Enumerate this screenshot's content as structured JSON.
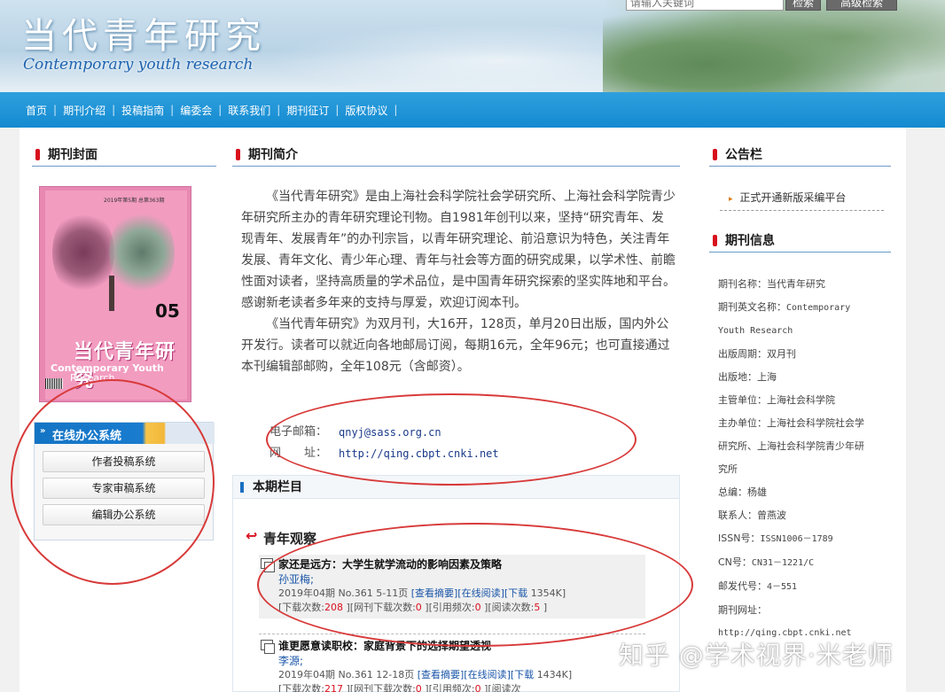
{
  "header": {
    "logo_cn": "当代青年研究",
    "logo_en": "Contemporary youth research",
    "search_placeholder": "请输入关键词",
    "search_button": "检索",
    "advanced_button": "高级检索"
  },
  "nav": {
    "items": [
      {
        "label": "首页"
      },
      {
        "label": "期刊介绍"
      },
      {
        "label": "投稿指南"
      },
      {
        "label": "编委会"
      },
      {
        "label": "联系我们"
      },
      {
        "label": "期刊征订"
      },
      {
        "label": "版权协议"
      }
    ]
  },
  "left": {
    "cover_title": "期刊封面",
    "cover": {
      "small": "2019年第5期 总第363期",
      "num": "05",
      "title_cn": "当代青年研究",
      "title_en": "Contemporary Youth",
      "title_en2": "Research"
    },
    "office_title": "在线办公系统",
    "office_buttons": [
      {
        "label": "作者投稿系统"
      },
      {
        "label": "专家审稿系统"
      },
      {
        "label": "编辑办公系统"
      }
    ]
  },
  "middle": {
    "intro_title": "期刊简介",
    "intro_p1": "《当代青年研究》是由上海社会科学院社会学研究所、上海社会科学院青少年研究所主办的青年研究理论刊物。自1981年创刊以来，坚持“研究青年、发现青年、发展青年”的办刊宗旨，以青年研究理论、前沿意识为特色，关注青年发展、青年文化、青少年心理、青年与社会等方面的研究成果，以学术性、前瞻性面对读者，坚持高质量的学术品位，是中国青年研究探索的坚实阵地和平台。感谢新老读者多年来的支持与厚爱，欢迎订阅本刊。",
    "intro_p2": "《当代青年研究》为双月刊，大16开，128页，单月20日出版，国内外公开发行。读者可以就近向各地邮局订阅，每期16元，全年96元；也可直接通过本刊编辑部邮购，全年108元（含邮资）。",
    "email_label": "电子邮箱：",
    "email": "qnyj@sass.org.cn",
    "site_label": "网　　址：",
    "site": "http://qing.cbpt.cnki.net",
    "columns_title": "本期栏目",
    "column_name": "青年观察",
    "articles": [
      {
        "title": "家还是远方：大学生就学流动的影响因素及策略",
        "author": "孙亚梅;",
        "meta": "2019年04期 No.361 5-11页",
        "links": "[查看摘要][在线阅读][下载",
        "size": "1354K]",
        "dl_label": "[下载次数:",
        "dl": "208",
        "net_label": "][网刊下载次数:",
        "net": "0",
        "cite_label": "][引用频次:",
        "cite": "0",
        "read_label": "][阅读次数:",
        "read": "5",
        "end": "]"
      },
      {
        "title": "谁更愿意读职校：家庭背景下的选择期望透视",
        "author": "李源;",
        "meta": "2019年04期 No.361 12-18页",
        "links": "[查看摘要][在线阅读][下载",
        "size": "1434K]",
        "dl_label": "[下载次数:",
        "dl": "217",
        "net_label": "][网刊下载次数:",
        "net": "0",
        "cite_label": "][引用频次:",
        "cite": "0",
        "read_label": "][阅读次",
        "read": "",
        "end": ""
      }
    ]
  },
  "right": {
    "notice_title": "公告栏",
    "notice_item": "正式开通新版采编平台",
    "info_title": "期刊信息",
    "info": {
      "name": "期刊名称：当代青年研究",
      "en_name_label": "期刊英文名称：",
      "en_name": "Contemporary",
      "en_name2": "Youth Research",
      "cycle": "出版周期：双月刊",
      "place": "出版地：上海",
      "supervisor": "主管单位：上海社会科学院",
      "sponsor1": "主办单位：上海社会科学院社会学",
      "sponsor2": "研究所、上海社会科学院青少年研",
      "sponsor3": "究所",
      "editor": "总编：杨雄",
      "contact": "联系人：曾燕波",
      "issn_label": "ISSN号：",
      "issn": "ISSN1006－1789",
      "cn_label": "CN号：",
      "cn": "CN31－1221/C",
      "post_label": "邮发代号：",
      "post": "4－551",
      "site_label": "期刊网址：",
      "site": "http://qing.cbpt.cnki.net"
    }
  },
  "watermark": "知乎 @学术视界·米老师",
  "colors": {
    "nav": "#148ad0",
    "accent_red": "#d8101d",
    "annotation": "#d83a3a"
  }
}
